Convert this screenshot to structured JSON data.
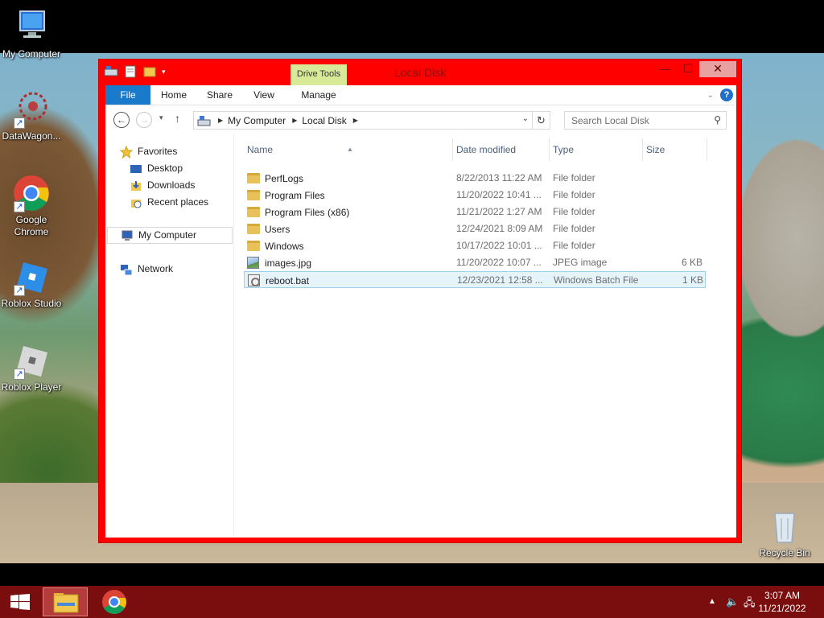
{
  "desktop": {
    "icons": [
      {
        "label": "My Computer"
      },
      {
        "label": "DataWagon..."
      },
      {
        "label": "Google Chrome"
      },
      {
        "label": "Roblox Studio"
      },
      {
        "label": "Roblox Player"
      },
      {
        "label": "Recycle Bin"
      }
    ]
  },
  "window": {
    "title": "Local Disk",
    "context_tab": "Drive Tools",
    "controls": {
      "minimize": "—",
      "maximize": "☐",
      "close": "✕"
    },
    "ribbon_tabs": [
      {
        "label": "File"
      },
      {
        "label": "Home"
      },
      {
        "label": "Share"
      },
      {
        "label": "View"
      },
      {
        "label": "Manage"
      }
    ],
    "help": "?"
  },
  "address": {
    "crumbs": [
      "My Computer",
      "Local Disk"
    ],
    "search_placeholder": "Search Local Disk"
  },
  "navpane": {
    "items": [
      {
        "label": "Favorites",
        "icon": "star-icon"
      },
      {
        "label": "Desktop",
        "icon": "desktop-icon"
      },
      {
        "label": "Downloads",
        "icon": "downloads-icon"
      },
      {
        "label": "Recent places",
        "icon": "recent-places-icon"
      },
      {
        "label": "My Computer",
        "icon": "computer-icon"
      },
      {
        "label": "Network",
        "icon": "network-icon"
      }
    ]
  },
  "columns": {
    "name": "Name",
    "date": "Date modified",
    "type": "Type",
    "size": "Size"
  },
  "files": [
    {
      "name": "PerfLogs",
      "date": "8/22/2013 11:22 AM",
      "type": "File folder",
      "size": "",
      "icon": "folder-icon"
    },
    {
      "name": "Program Files",
      "date": "11/20/2022 10:41 ...",
      "type": "File folder",
      "size": "",
      "icon": "folder-icon"
    },
    {
      "name": "Program Files (x86)",
      "date": "11/21/2022 1:27 AM",
      "type": "File folder",
      "size": "",
      "icon": "folder-icon"
    },
    {
      "name": "Users",
      "date": "12/24/2021 8:09 AM",
      "type": "File folder",
      "size": "",
      "icon": "folder-icon"
    },
    {
      "name": "Windows",
      "date": "10/17/2022 10:01 ...",
      "type": "File folder",
      "size": "",
      "icon": "folder-icon"
    },
    {
      "name": "images.jpg",
      "date": "11/20/2022 10:07 ...",
      "type": "JPEG image",
      "size": "6 KB",
      "icon": "image-file-icon"
    },
    {
      "name": "reboot.bat",
      "date": "12/23/2021 12:58 ...",
      "type": "Windows Batch File",
      "size": "1 KB",
      "icon": "batch-file-icon"
    }
  ],
  "taskbar": {
    "clock_time": "3:07 AM",
    "clock_date": "11/21/2022"
  },
  "colors": {
    "window_frame": "#ff0000",
    "taskbar": "#7a0d0d",
    "file_tab": "#1979ca",
    "context_tab": "#d8ea98",
    "selection": "#e5f3fb"
  }
}
